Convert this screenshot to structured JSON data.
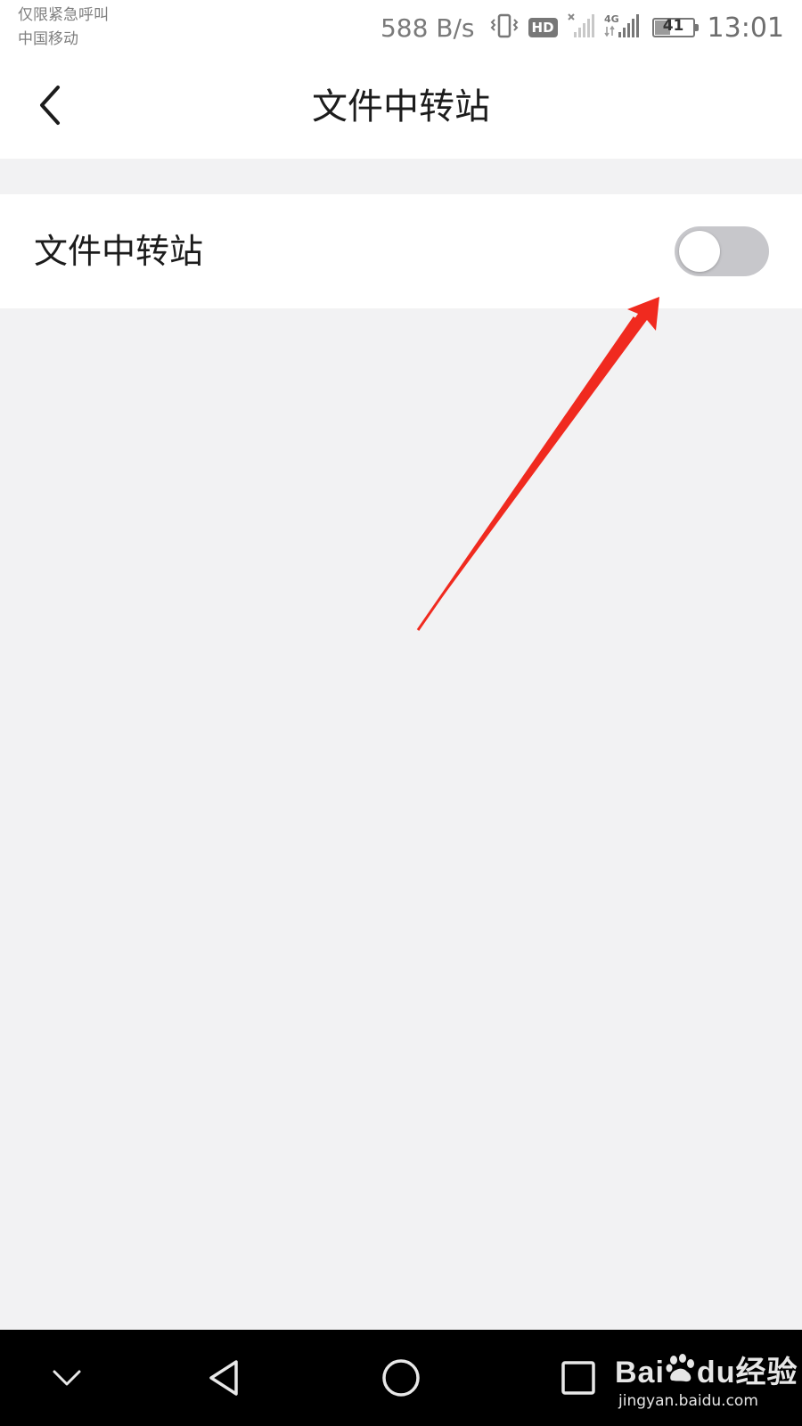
{
  "status_bar": {
    "emergency_text": "仅限紧急呼叫",
    "carrier": "中国移动",
    "net_speed": "588 B/s",
    "vibrate_icon": "vibrate-icon",
    "hd_label": "HD",
    "network_type": "4G",
    "battery_level": "41",
    "battery_fraction": 0.41,
    "time": "13:01"
  },
  "header": {
    "title": "文件中转站",
    "back_icon": "chevron-left-icon"
  },
  "settings": {
    "rows": [
      {
        "label": "文件中转站",
        "toggle_on": false
      }
    ]
  },
  "nav_bar": {
    "buttons": [
      "collapse-down-icon",
      "back-triangle-icon",
      "home-circle-icon",
      "recents-square-icon"
    ]
  },
  "watermark": {
    "brand_a": "Bai",
    "brand_b": "du",
    "brand_suffix": "经验",
    "url": "jingyan.baidu.com"
  },
  "colors": {
    "background": "#f2f2f3",
    "surface": "#ffffff",
    "toggle_off": "#c7c7cb",
    "annotation_arrow": "#f02a1f",
    "nav_bar": "#000000"
  }
}
